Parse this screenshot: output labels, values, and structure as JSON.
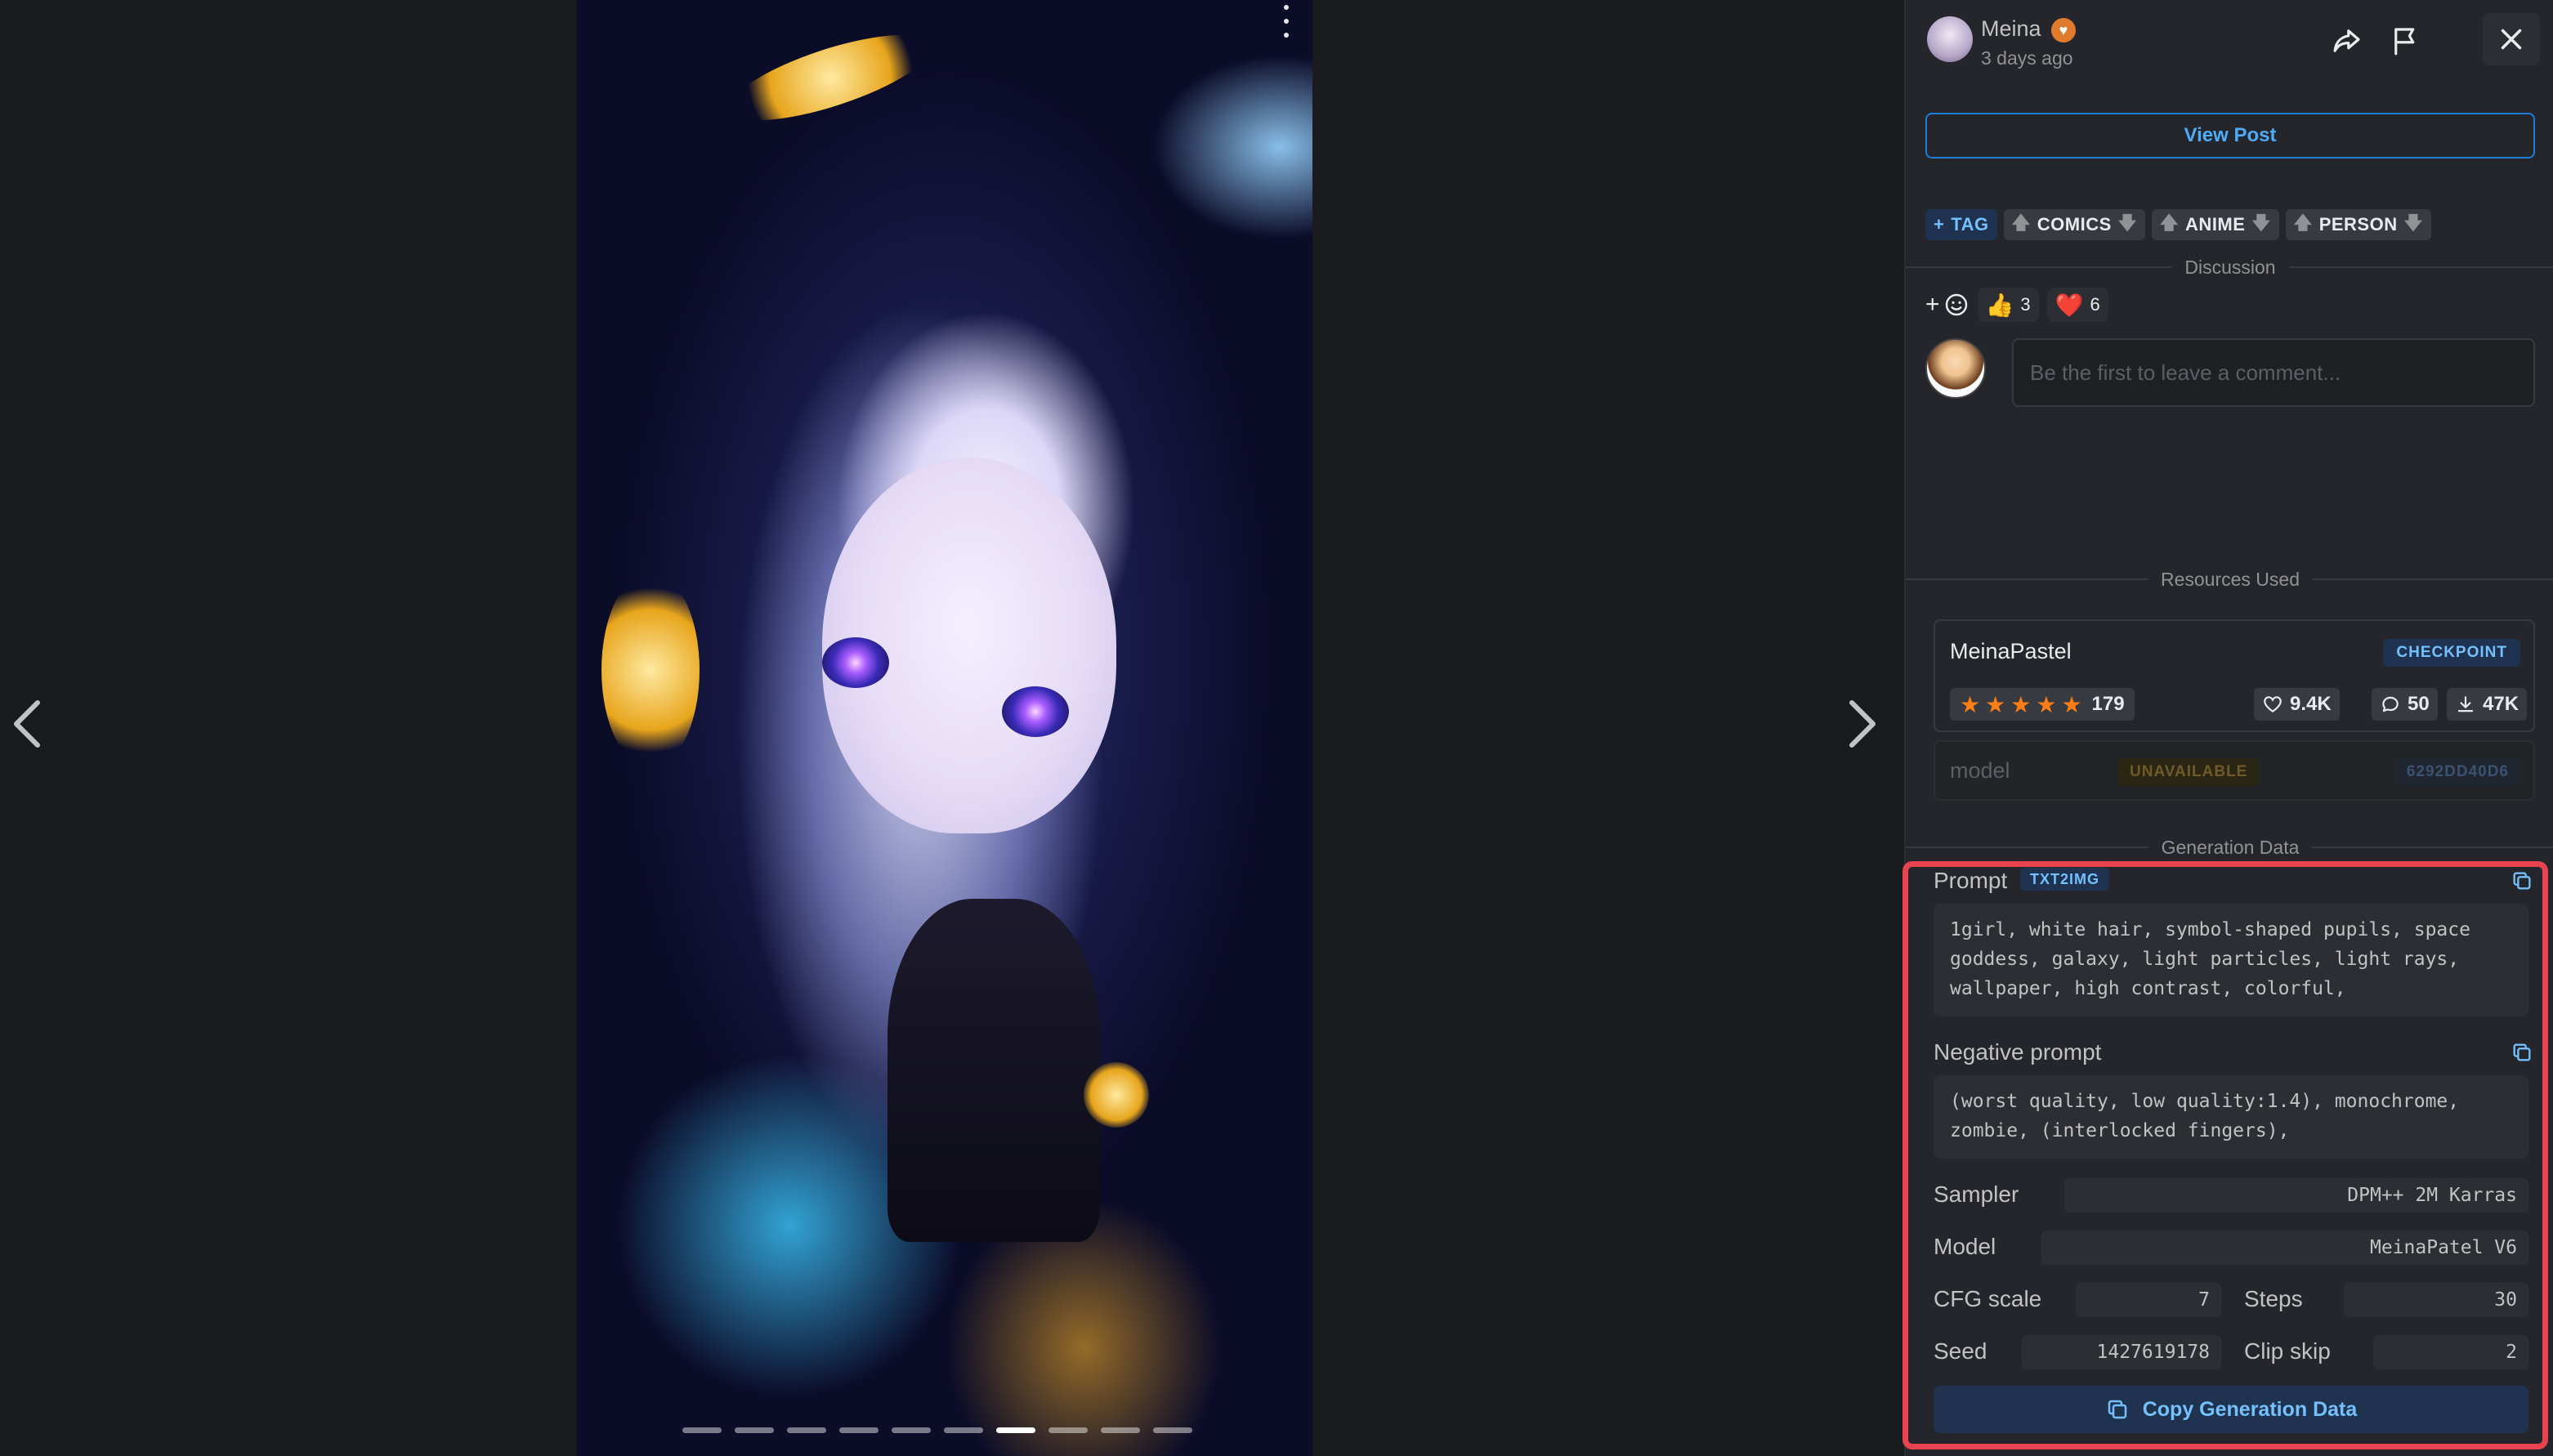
{
  "post": {
    "username": "Meina",
    "time_ago": "3 days ago",
    "view_post_label": "View Post",
    "image_pages": 10,
    "active_page": 6
  },
  "tags": {
    "add_label": "TAG",
    "items": [
      "COMICS",
      "ANIME",
      "PERSON"
    ]
  },
  "discussion": {
    "section_label": "Discussion",
    "reactions": [
      {
        "emoji": "👍",
        "count": "3"
      },
      {
        "emoji": "❤️",
        "count": "6"
      }
    ],
    "comment_placeholder": "Be the first to leave a comment..."
  },
  "resources": {
    "section_label": "Resources Used",
    "main": {
      "name": "MeinaPastel",
      "type": "CHECKPOINT",
      "rating_count": "179",
      "likes": "9.4K",
      "comments": "50",
      "downloads": "47K"
    },
    "unavailable": {
      "name": "model",
      "status": "UNAVAILABLE",
      "hash": "6292DD40D6"
    }
  },
  "generation": {
    "section_label": "Generation Data",
    "prompt_label": "Prompt",
    "prompt_badge": "TXT2IMG",
    "prompt": "1girl, white hair, symbol-shaped pupils, space goddess, galaxy, light particles, light rays, wallpaper, high contrast, colorful,",
    "negative_label": "Negative prompt",
    "negative": "(worst quality, low quality:1.4), monochrome, zombie, (interlocked fingers),",
    "sampler_label": "Sampler",
    "sampler": "DPM++ 2M Karras",
    "model_label": "Model",
    "model": "MeinaPatel V6",
    "cfg_label": "CFG scale",
    "cfg": "7",
    "steps_label": "Steps",
    "steps": "30",
    "seed_label": "Seed",
    "seed": "1427619178",
    "clip_label": "Clip skip",
    "clip": "2",
    "copy_label": "Copy Generation Data"
  },
  "colors": {
    "highlight_border": "#e8434f",
    "accent": "#4dabf7",
    "star": "#fd7e14"
  },
  "icons": [
    "chevron-left-icon",
    "chevron-right-icon",
    "more-vertical-icon",
    "share-icon",
    "flag-icon",
    "close-icon",
    "plus-icon",
    "smile-icon",
    "heart-icon",
    "comment-icon",
    "download-icon",
    "copy-icon",
    "arrow-up-icon",
    "arrow-down-icon",
    "star-icon"
  ]
}
